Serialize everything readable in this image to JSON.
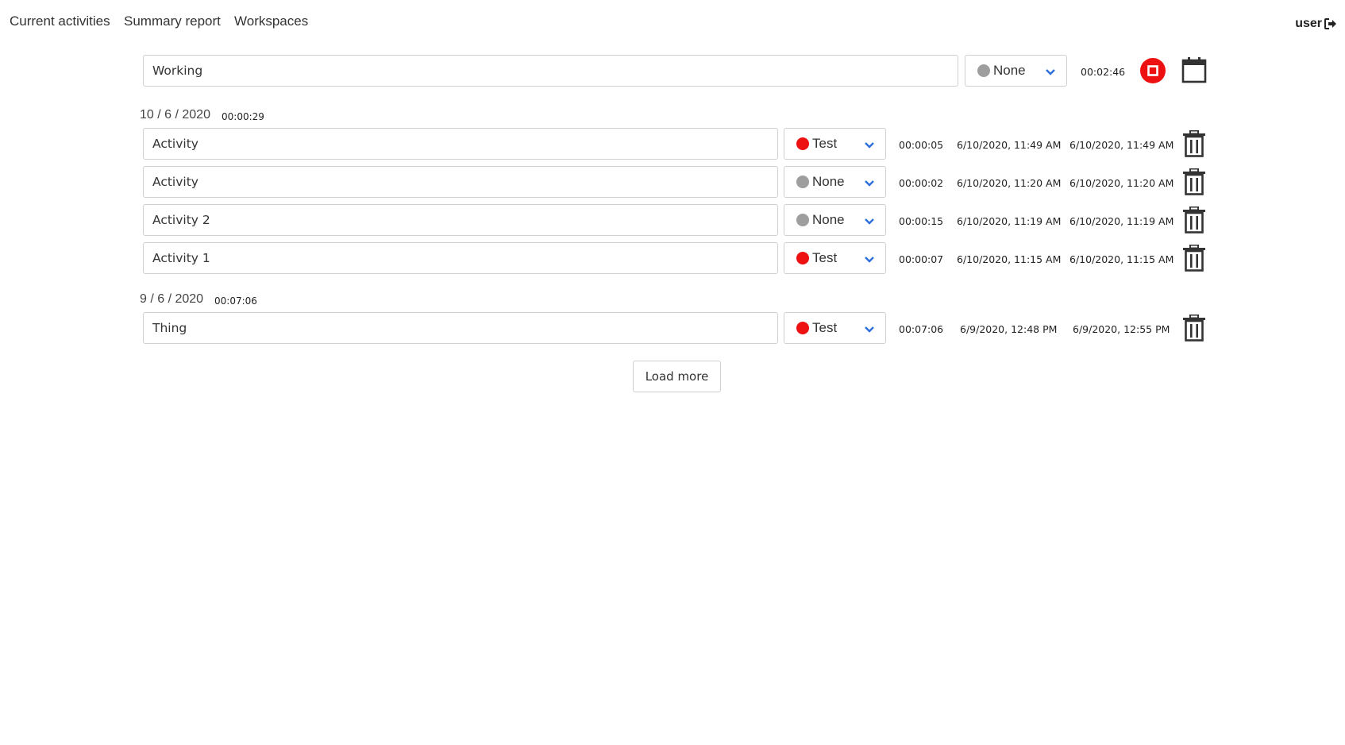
{
  "nav": {
    "items": [
      "Current activities",
      "Summary report",
      "Workspaces"
    ],
    "user": "user"
  },
  "colors": {
    "tag_test": "#ee1111",
    "tag_none": "#9e9e9e",
    "chevron": "#2f6fdb",
    "stop": "#ee1111"
  },
  "current": {
    "name": "Working",
    "tag": "None",
    "duration": "00:02:46"
  },
  "groups": [
    {
      "date": "10 / 6 / 2020",
      "total": "00:00:29",
      "entries": [
        {
          "name": "Activity",
          "tag": "Test",
          "duration": "00:00:05",
          "start": "6/10/2020, 11:49 AM",
          "end": "6/10/2020, 11:49 AM"
        },
        {
          "name": "Activity",
          "tag": "None",
          "duration": "00:00:02",
          "start": "6/10/2020, 11:20 AM",
          "end": "6/10/2020, 11:20 AM"
        },
        {
          "name": "Activity 2",
          "tag": "None",
          "duration": "00:00:15",
          "start": "6/10/2020, 11:19 AM",
          "end": "6/10/2020, 11:19 AM"
        },
        {
          "name": "Activity 1",
          "tag": "Test",
          "duration": "00:00:07",
          "start": "6/10/2020, 11:15 AM",
          "end": "6/10/2020, 11:15 AM"
        }
      ]
    },
    {
      "date": "9 / 6 / 2020",
      "total": "00:07:06",
      "entries": [
        {
          "name": "Thing",
          "tag": "Test",
          "duration": "00:07:06",
          "start": "6/9/2020, 12:48 PM",
          "end": "6/9/2020, 12:55 PM"
        }
      ]
    }
  ],
  "load_more_label": "Load more"
}
